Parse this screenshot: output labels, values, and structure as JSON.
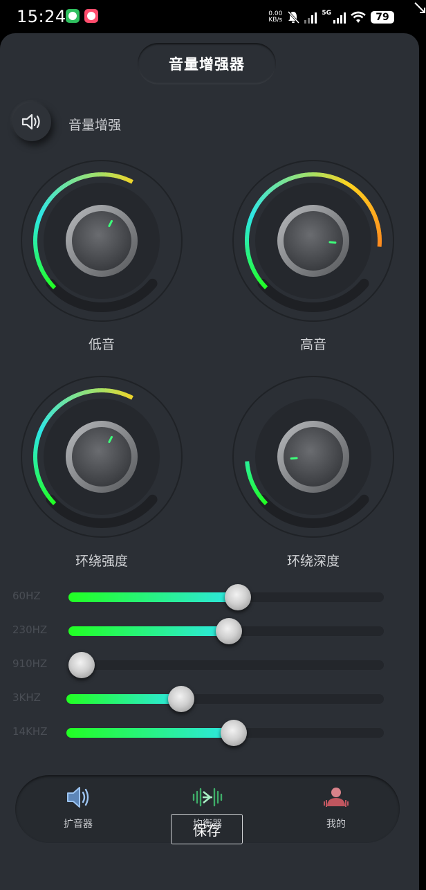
{
  "status_bar": {
    "time": "15:24",
    "net_speed_value": "0.00",
    "net_speed_unit": "KB/s",
    "network_type": "5G",
    "battery": "79"
  },
  "header": {
    "title": "音量增强器"
  },
  "enhance": {
    "label": "音量增强",
    "icon": "speaker-icon"
  },
  "knobs": [
    {
      "label": "低音",
      "level": 0.6
    },
    {
      "label": "高音",
      "level": 0.85
    },
    {
      "label": "环绕强度",
      "level": 0.6
    },
    {
      "label": "环绕深度",
      "level": 0.15
    }
  ],
  "equalizer": {
    "bands": [
      {
        "label": "60HZ",
        "value": 0.54
      },
      {
        "label": "230HZ",
        "value": 0.51
      },
      {
        "label": "910HZ",
        "value": 0.0
      },
      {
        "label": "3KHZ",
        "value": 0.35
      },
      {
        "label": "14KHZ",
        "value": 0.53
      }
    ]
  },
  "nav": {
    "items": [
      {
        "label": "扩音器",
        "icon": "speaker-icon"
      },
      {
        "label": "均衡器",
        "icon": "equalizer-icon"
      },
      {
        "label": "我的",
        "icon": "profile-icon"
      }
    ]
  },
  "save_button": {
    "label": "保存"
  },
  "colors": {
    "panel": "#2b2f35",
    "accent_green": "#22ff22",
    "accent_cyan": "#2ee6e6",
    "arc_yellow": "#ffd21f",
    "arc_red": "#ff1a1a"
  }
}
